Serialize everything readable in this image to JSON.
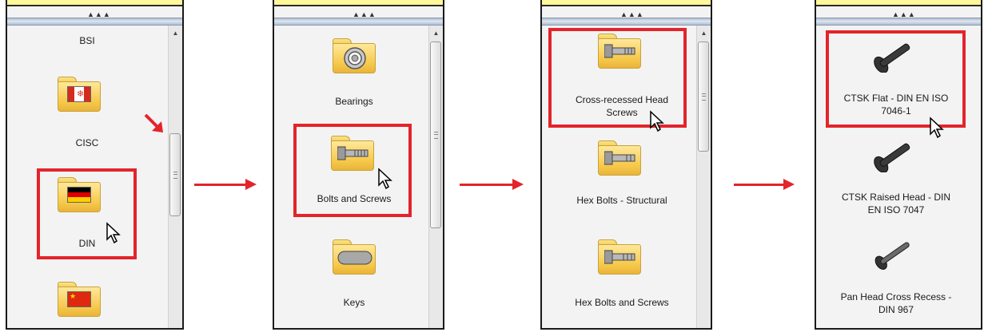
{
  "panel1": {
    "items": [
      {
        "label": "BSI"
      },
      {
        "label": "CISC"
      },
      {
        "label": "DIN"
      },
      {
        "label": ""
      }
    ]
  },
  "panel2": {
    "items": [
      {
        "label": "Bearings"
      },
      {
        "label": "Bolts and Screws"
      },
      {
        "label": "Keys"
      }
    ]
  },
  "panel3": {
    "items": [
      {
        "label_line1": "Cross-recessed Head",
        "label_line2": "Screws"
      },
      {
        "label": "Hex Bolts - Structural"
      },
      {
        "label": "Hex Bolts and Screws"
      }
    ]
  },
  "panel4": {
    "items": [
      {
        "label_line1": "CTSK Flat - DIN EN ISO",
        "label_line2": "7046-1"
      },
      {
        "label_line1": "CTSK Raised Head - DIN",
        "label_line2": "EN ISO 7047"
      },
      {
        "label_line1": "Pan Head Cross Recess -",
        "label_line2": "DIN 967"
      }
    ]
  },
  "icons": {
    "folder": "folder-icon",
    "flag_canada": "canada-flag-icon",
    "flag_germany": "germany-flag-icon",
    "flag_china": "china-flag-icon",
    "bearing": "bearing-icon",
    "bolt": "bolt-icon",
    "key": "key-icon",
    "screw": "screw-icon",
    "cursor": "mouse-cursor-icon",
    "arrow": "right-arrow-icon"
  },
  "colors": {
    "highlight": "#e3242b",
    "folder": "#f6c84a",
    "panel_bg": "#f3f3f3"
  }
}
